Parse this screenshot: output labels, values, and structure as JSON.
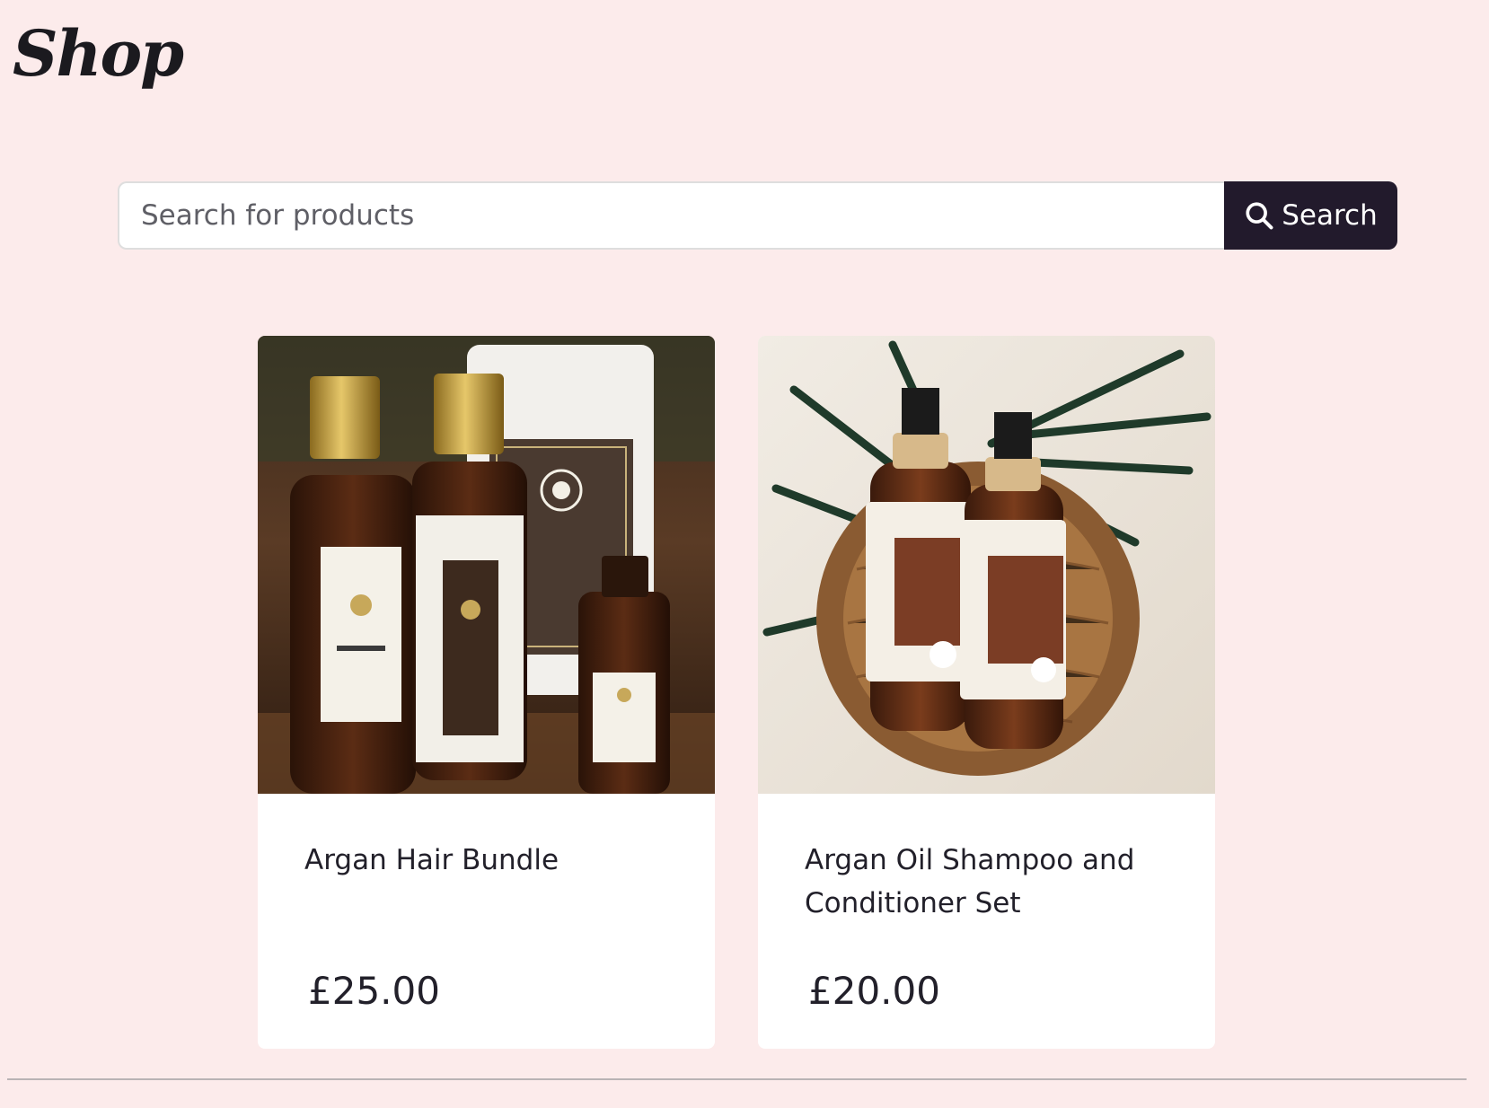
{
  "header": {
    "title": "Shop"
  },
  "search": {
    "placeholder": "Search for products",
    "button_label": "Search",
    "icon": "search-icon"
  },
  "colors": {
    "background": "#fcebeb",
    "search_button": "#221a2c",
    "card": "#ffffff"
  },
  "products": [
    {
      "name": "Argan Hair Bundle",
      "price": "£25.00",
      "image": "argan-hair-bundle-photo"
    },
    {
      "name": "Argan Oil Shampoo and Conditioner Set",
      "price": "£20.00",
      "image": "argan-shampoo-conditioner-basket-photo"
    }
  ]
}
